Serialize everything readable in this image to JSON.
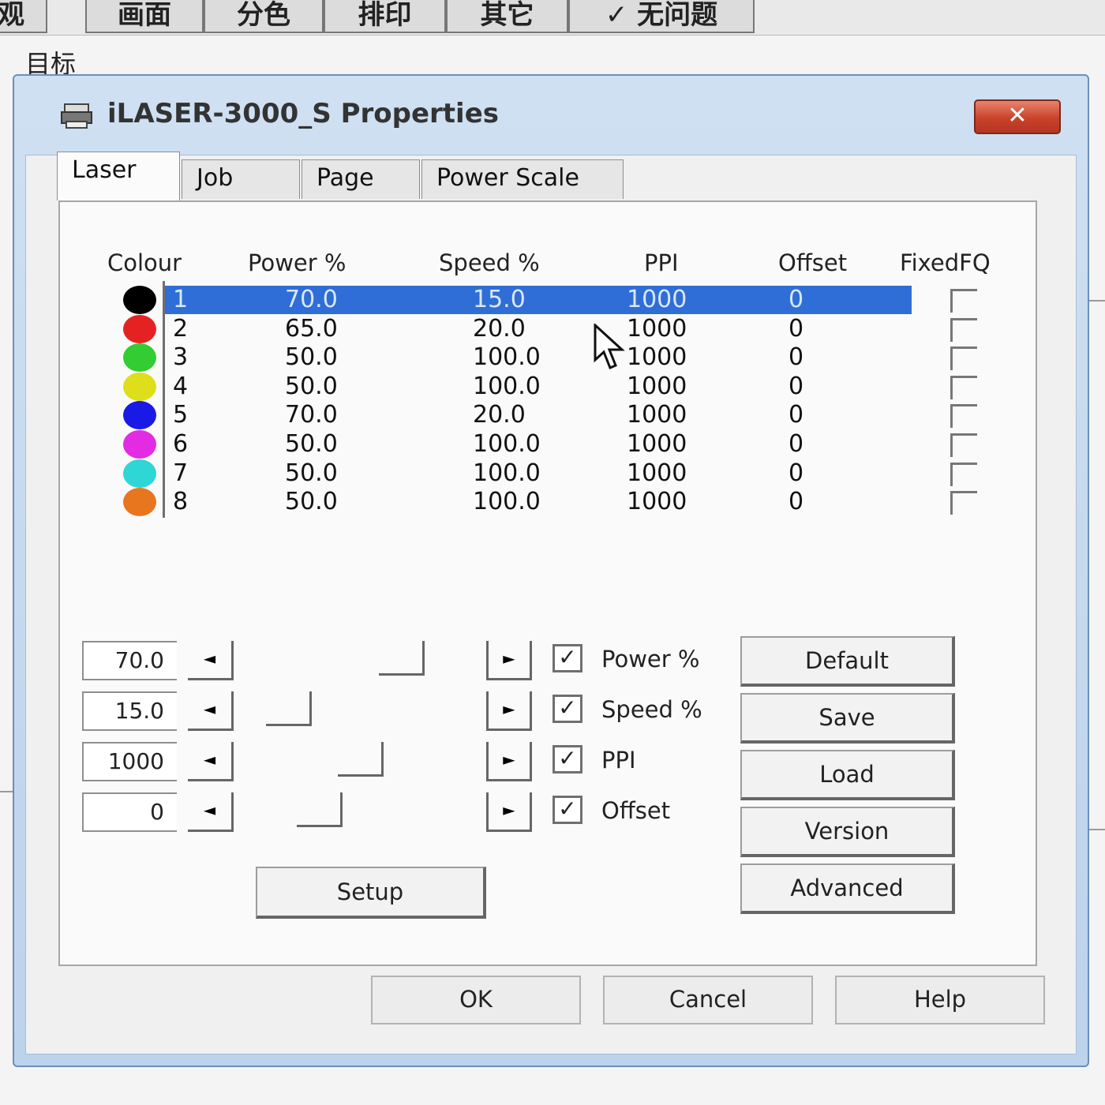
{
  "background": {
    "tabs": [
      "观",
      "画面",
      "分色",
      "排印",
      "其它",
      "✓ 无问题"
    ],
    "label": "目标"
  },
  "dialog": {
    "title": "iLASER-3000_S Properties",
    "close_label": "✕",
    "tabs": [
      "Laser",
      "Job",
      "Page",
      "Power Scale"
    ],
    "active_tab": "Laser",
    "columns": {
      "colour": "Colour",
      "power": "Power %",
      "speed": "Speed %",
      "ppi": "PPI",
      "offset": "Offset",
      "fixedfq": "FixedFQ"
    },
    "rows": [
      {
        "index": "1",
        "color": "#000000",
        "power": "70.0",
        "speed": "15.0",
        "ppi": "1000",
        "offset": "0",
        "selected": true
      },
      {
        "index": "2",
        "color": "#e52222",
        "power": "65.0",
        "speed": "20.0",
        "ppi": "1000",
        "offset": "0"
      },
      {
        "index": "3",
        "color": "#33cc33",
        "power": "50.0",
        "speed": "100.0",
        "ppi": "1000",
        "offset": "0"
      },
      {
        "index": "4",
        "color": "#dede1a",
        "power": "50.0",
        "speed": "100.0",
        "ppi": "1000",
        "offset": "0"
      },
      {
        "index": "5",
        "color": "#1a1ae6",
        "power": "70.0",
        "speed": "20.0",
        "ppi": "1000",
        "offset": "0"
      },
      {
        "index": "6",
        "color": "#e22be2",
        "power": "50.0",
        "speed": "100.0",
        "ppi": "1000",
        "offset": "0"
      },
      {
        "index": "7",
        "color": "#2ed6d6",
        "power": "50.0",
        "speed": "100.0",
        "ppi": "1000",
        "offset": "0"
      },
      {
        "index": "8",
        "color": "#e8761e",
        "power": "50.0",
        "speed": "100.0",
        "ppi": "1000",
        "offset": "0"
      }
    ],
    "editors": [
      {
        "value": "70.0",
        "label": "Power %",
        "checked": true,
        "level": 0.7
      },
      {
        "value": "15.0",
        "label": "Speed %",
        "checked": true,
        "level": 0.15
      },
      {
        "value": "1000",
        "label": "PPI",
        "checked": true,
        "level": 0.5
      },
      {
        "value": "0",
        "label": "Offset",
        "checked": true,
        "level": 0.3
      }
    ],
    "spin_left": "◄",
    "spin_right": "►",
    "check_mark": "✓",
    "side_buttons": [
      "Default",
      "Save",
      "Load",
      "Version",
      "Advanced"
    ],
    "setup_button": "Setup",
    "footer_buttons": [
      "OK",
      "Cancel",
      "Help"
    ]
  }
}
